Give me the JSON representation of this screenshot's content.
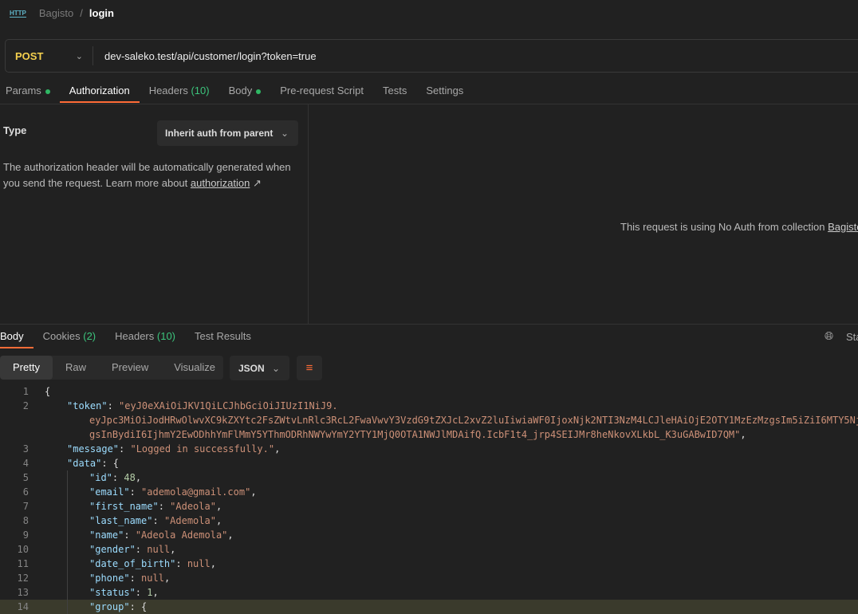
{
  "breadcrumb": {
    "icon": "http-icon",
    "icon_text": "HTTP",
    "parent": "Bagisto",
    "separator": "/",
    "current": "login"
  },
  "request": {
    "method": "POST",
    "url": "dev-saleko.test/api/customer/login?token=true"
  },
  "request_tabs": [
    {
      "label": "Params",
      "dot": true
    },
    {
      "label": "Authorization",
      "active": true
    },
    {
      "label": "Headers",
      "count": "(10)"
    },
    {
      "label": "Body",
      "dot": true
    },
    {
      "label": "Pre-request Script"
    },
    {
      "label": "Tests"
    },
    {
      "label": "Settings"
    }
  ],
  "auth": {
    "type_label": "Type",
    "type_value": "Inherit auth from parent",
    "desc": "The authorization header will be automatically generated when you send the request. Learn more about ",
    "link": "authorization",
    "link_arrow": "↗",
    "no_auth_text": "This request is using No Auth from collection ",
    "collection_link": "Bagisto"
  },
  "response_tabs": [
    {
      "label": "Body",
      "active": true
    },
    {
      "label": "Cookies",
      "count": "(2)"
    },
    {
      "label": "Headers",
      "count": "(10)"
    },
    {
      "label": "Test Results"
    }
  ],
  "status_label": "Sta",
  "views": [
    "Pretty",
    "Raw",
    "Preview",
    "Visualize"
  ],
  "format": "JSON",
  "colors": {
    "accent": "#ff6c37",
    "method": "#f5d04e",
    "key": "#9cdcfe",
    "string": "#ce9178",
    "number": "#b5cea8"
  },
  "code_lines": [
    {
      "n": "1",
      "i": 0,
      "parts": [
        [
          "p",
          "{"
        ]
      ]
    },
    {
      "n": "2",
      "i": 1,
      "parts": [
        [
          "k",
          "\"token\""
        ],
        [
          "p",
          ": "
        ],
        [
          "s",
          "\"eyJ0eXAiOiJKV1QiLCJhbGciOiJIUzI1NiJ9."
        ]
      ]
    },
    {
      "n": "",
      "i": 2,
      "parts": [
        [
          "s",
          "eyJpc3MiOiJodHRwOlwvXC9kZXYtc2FsZWtvLnRlc3RcL2FwaVwvY3VzdG9tZXJcL2xvZ2luIiwiaWF0IjoxNjk2NTI3NzM4LCJleHAiOjE2OTY1MzEzMzgsIm5iZiI6MTY5Nj"
        ]
      ]
    },
    {
      "n": "",
      "i": 2,
      "parts": [
        [
          "s",
          "gsInBydiI6IjhmY2EwODhhYmFlMmY5YThmODRhNWYwYmY2YTY1MjQ0OTA1NWJlMDAifQ.IcbF1t4_jrp4SEIJMr8heNkovXLkbL_K3uGABwID7QM\""
        ],
        [
          "p",
          ","
        ]
      ]
    },
    {
      "n": "3",
      "i": 1,
      "parts": [
        [
          "k",
          "\"message\""
        ],
        [
          "p",
          ": "
        ],
        [
          "s",
          "\"Logged in successfully.\""
        ],
        [
          "p",
          ","
        ]
      ]
    },
    {
      "n": "4",
      "i": 1,
      "parts": [
        [
          "k",
          "\"data\""
        ],
        [
          "p",
          ": {"
        ]
      ]
    },
    {
      "n": "5",
      "i": 2,
      "parts": [
        [
          "k",
          "\"id\""
        ],
        [
          "p",
          ": "
        ],
        [
          "n",
          "48"
        ],
        [
          "p",
          ","
        ]
      ]
    },
    {
      "n": "6",
      "i": 2,
      "parts": [
        [
          "k",
          "\"email\""
        ],
        [
          "p",
          ": "
        ],
        [
          "s",
          "\"ademola@gmail.com\""
        ],
        [
          "p",
          ","
        ]
      ]
    },
    {
      "n": "7",
      "i": 2,
      "parts": [
        [
          "k",
          "\"first_name\""
        ],
        [
          "p",
          ": "
        ],
        [
          "s",
          "\"Adeola\""
        ],
        [
          "p",
          ","
        ]
      ]
    },
    {
      "n": "8",
      "i": 2,
      "parts": [
        [
          "k",
          "\"last_name\""
        ],
        [
          "p",
          ": "
        ],
        [
          "s",
          "\"Ademola\""
        ],
        [
          "p",
          ","
        ]
      ]
    },
    {
      "n": "9",
      "i": 2,
      "parts": [
        [
          "k",
          "\"name\""
        ],
        [
          "p",
          ": "
        ],
        [
          "s",
          "\"Adeola Ademola\""
        ],
        [
          "p",
          ","
        ]
      ]
    },
    {
      "n": "10",
      "i": 2,
      "parts": [
        [
          "k",
          "\"gender\""
        ],
        [
          "p",
          ": "
        ],
        [
          "nl",
          "null"
        ],
        [
          "p",
          ","
        ]
      ]
    },
    {
      "n": "11",
      "i": 2,
      "parts": [
        [
          "k",
          "\"date_of_birth\""
        ],
        [
          "p",
          ": "
        ],
        [
          "nl",
          "null"
        ],
        [
          "p",
          ","
        ]
      ]
    },
    {
      "n": "12",
      "i": 2,
      "parts": [
        [
          "k",
          "\"phone\""
        ],
        [
          "p",
          ": "
        ],
        [
          "nl",
          "null"
        ],
        [
          "p",
          ","
        ]
      ]
    },
    {
      "n": "13",
      "i": 2,
      "parts": [
        [
          "k",
          "\"status\""
        ],
        [
          "p",
          ": "
        ],
        [
          "n",
          "1"
        ],
        [
          "p",
          ","
        ]
      ]
    },
    {
      "n": "14",
      "i": 2,
      "hl": true,
      "parts": [
        [
          "k",
          "\"group\""
        ],
        [
          "p",
          ": {"
        ]
      ]
    }
  ]
}
